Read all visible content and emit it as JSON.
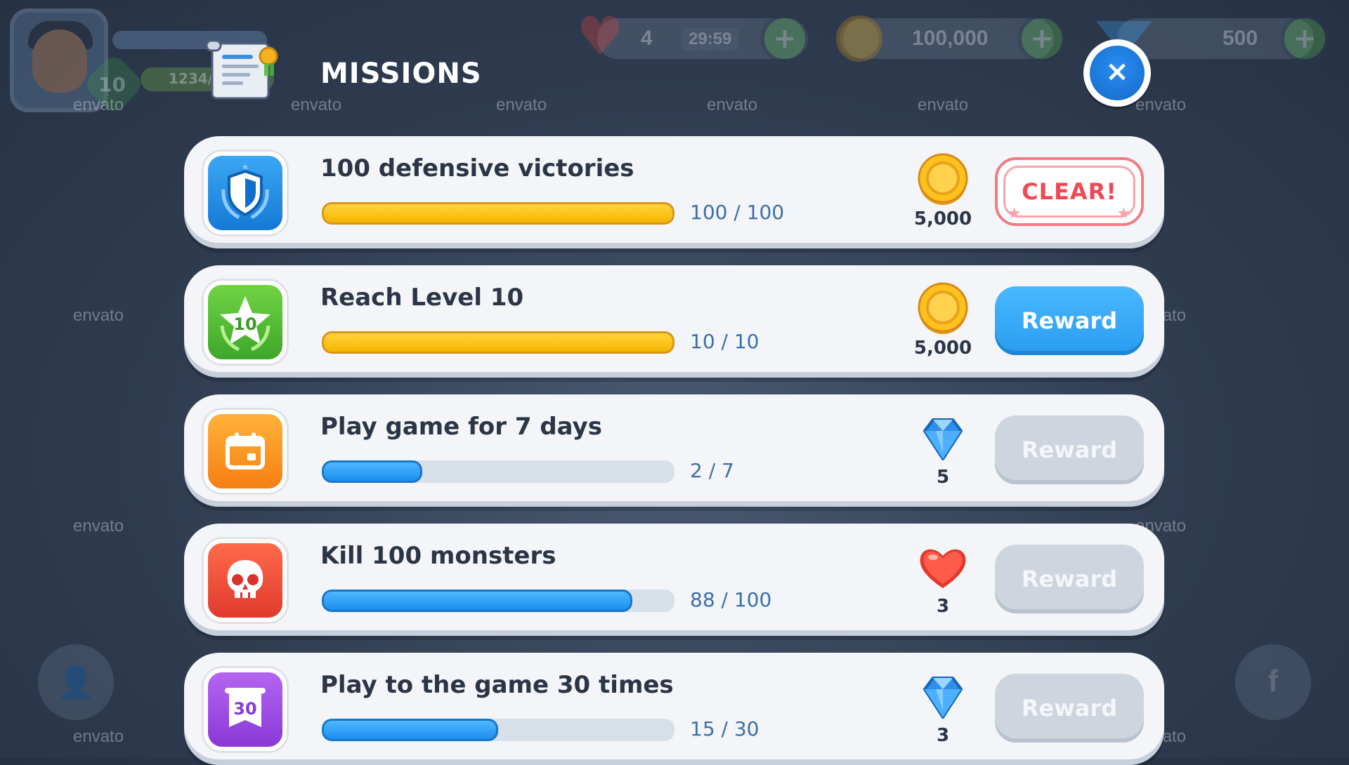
{
  "header": {
    "title": "MISSIONS",
    "close_label": "×"
  },
  "background_hud": {
    "player_level": "10",
    "xp_text": "1234/5",
    "lives": "4",
    "life_timer": "29:59",
    "coins": "100,000",
    "gems": "500"
  },
  "watermark_text": "envato",
  "missions": [
    {
      "title": "100 defensive victories",
      "progress_text": "100 / 100",
      "progress_fraction": 1.0,
      "bar_color": "yellow",
      "icon": "shield-icon",
      "reward_type": "coin-icon",
      "reward_amount": "5,000",
      "button_label": "CLEAR!",
      "button_state": "cleared"
    },
    {
      "title": "Reach Level 10",
      "progress_text": "10 / 10",
      "progress_fraction": 1.0,
      "bar_color": "yellow",
      "icon": "star-level-icon",
      "reward_type": "coin-icon",
      "reward_amount": "5,000",
      "button_label": "Reward",
      "button_state": "active"
    },
    {
      "title": "Play game for 7 days",
      "progress_text": "2 / 7",
      "progress_fraction": 0.2857,
      "bar_color": "blue",
      "icon": "calendar-icon",
      "reward_type": "diamond-icon",
      "reward_amount": "5",
      "button_label": "Reward",
      "button_state": "disabled"
    },
    {
      "title": "Kill 100 monsters",
      "progress_text": "88 / 100",
      "progress_fraction": 0.88,
      "bar_color": "blue",
      "icon": "skull-icon",
      "reward_type": "heart-icon",
      "reward_amount": "3",
      "button_label": "Reward",
      "button_state": "disabled"
    },
    {
      "title": "Play to the game 30 times",
      "progress_text": "15 / 30",
      "progress_fraction": 0.5,
      "bar_color": "blue",
      "icon": "banner-30-icon",
      "icon_text": "30",
      "reward_type": "diamond-icon",
      "reward_amount": "3",
      "button_label": "Reward",
      "button_state": "disabled"
    }
  ],
  "colors": {
    "shield_icon_bg": "#1f8fe6",
    "level_icon_bg": "#5ec23a",
    "calendar_icon_bg": "#ff9b1f",
    "skull_icon_bg": "#f2503c",
    "banner_icon_bg": "#9b4be0",
    "active_button": "#2a9cf0",
    "clear_button_text": "#ee4a56"
  }
}
